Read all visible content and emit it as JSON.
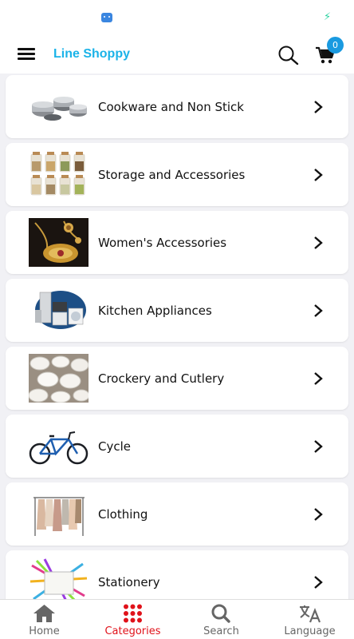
{
  "app": {
    "title": "Line Shoppy"
  },
  "header": {
    "cart_count": "0"
  },
  "categories": [
    {
      "label": "Cookware and Non Stick",
      "image": "cookware-image"
    },
    {
      "label": "Storage and Accessories",
      "image": "storage-jars-image"
    },
    {
      "label": "Women's Accessories",
      "image": "jewelry-image"
    },
    {
      "label": "Kitchen Appliances",
      "image": "appliances-image"
    },
    {
      "label": "Crockery and Cutlery",
      "image": "crockery-image"
    },
    {
      "label": "Cycle",
      "image": "bicycle-image"
    },
    {
      "label": "Clothing",
      "image": "clothing-rack-image"
    },
    {
      "label": "Stationery",
      "image": "stationery-image"
    }
  ],
  "bottom_nav": [
    {
      "label": "Home",
      "icon": "home-icon"
    },
    {
      "label": "Categories",
      "icon": "grid-icon",
      "active": true
    },
    {
      "label": "Search",
      "icon": "search-icon"
    },
    {
      "label": "Language",
      "icon": "translate-icon"
    }
  ],
  "colors": {
    "brand": "#1bb3e8",
    "active_nav": "#e0121a",
    "badge": "#1a9ae0"
  }
}
